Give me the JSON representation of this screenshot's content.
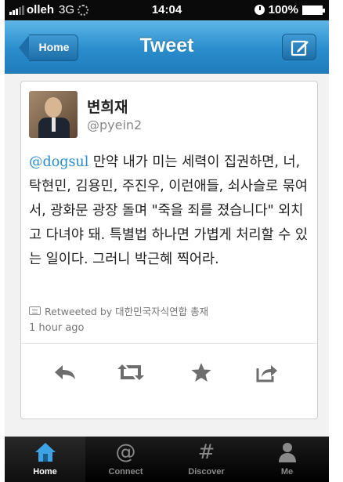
{
  "status_bar": {
    "carrier": "olleh",
    "network": "3G",
    "time": "14:04",
    "battery": "100%"
  },
  "nav": {
    "title": "Tweet",
    "back_label": "Home"
  },
  "tweet": {
    "author_name": "변희재",
    "author_handle": "@pyein2",
    "mention": "@dogsul",
    "text": " 만약 내가 미는 세력이 집권하면, 너, 탁현민, 김용민, 주진우, 이런애들, 쇠사슬로 묶여서, 광화문 광장 돌며 \"죽을 죄를 졌습니다\" 외치고 다녀야 돼. 특별법 하나면 가볍게 처리할 수 있는 일이다. 그러니 박근혜 찍어라.",
    "retweeted_by": "Retweeted by 대한민국자식연합 총재",
    "timestamp": "1 hour ago"
  },
  "actions": [
    "reply-icon",
    "retweet-icon",
    "favorite-icon",
    "share-icon"
  ],
  "tabs": [
    {
      "label": "Home",
      "icon": "home-icon",
      "active": true
    },
    {
      "label": "Connect",
      "icon": "at-icon",
      "active": false
    },
    {
      "label": "Discover",
      "icon": "hash-icon",
      "active": false
    },
    {
      "label": "Me",
      "icon": "person-icon",
      "active": false
    }
  ],
  "colors": {
    "nav_blue": "#2a8dcc",
    "mention": "#2a8ccc",
    "active_tab": "#3ea3e6"
  }
}
